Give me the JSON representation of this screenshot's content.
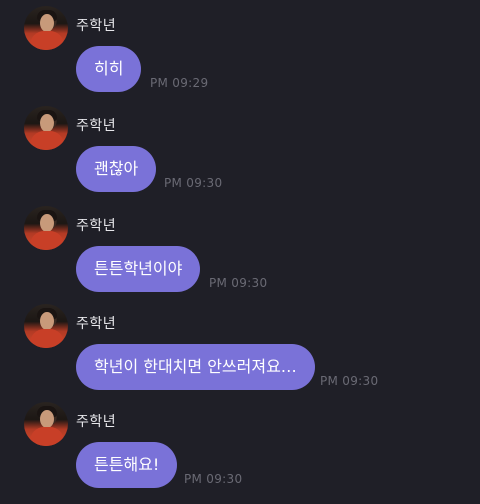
{
  "messages": [
    {
      "sender": "주학년",
      "text": "히히",
      "time": "PM 09:29"
    },
    {
      "sender": "주학년",
      "text": "괜찮아",
      "time": "PM 09:30"
    },
    {
      "sender": "주학년",
      "text": "튼튼학년이야",
      "time": "PM 09:30"
    },
    {
      "sender": "주학년",
      "text": "학년이 한대치면 안쓰러져요…",
      "time": "PM 09:30"
    },
    {
      "sender": "주학년",
      "text": "튼튼해요!",
      "time": "PM 09:30"
    }
  ],
  "colors": {
    "background": "#1f1f27",
    "bubble": "#7a72d8",
    "bubble_text": "#ffffff",
    "sender_text": "#e6e6ea",
    "timestamp_text": "#6a6a74"
  }
}
